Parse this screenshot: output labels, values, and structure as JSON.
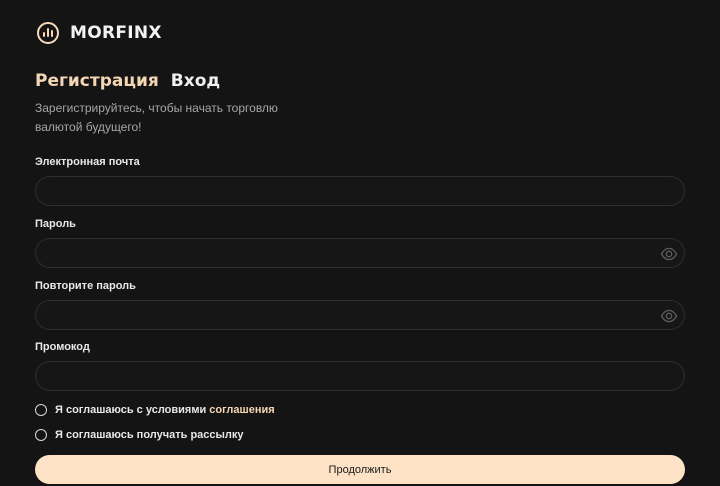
{
  "header": {
    "brand": "MORFINX",
    "logo_icon": "chart-bars-circle-icon"
  },
  "tabs": [
    {
      "label": "Регистрация",
      "active": true
    },
    {
      "label": "Вход",
      "active": false
    }
  ],
  "subtitle": "Зарегистрируйтесь, чтобы начать торговлю валютой будущего!",
  "form": {
    "email": {
      "label": "Электронная почта",
      "value": "",
      "placeholder": ""
    },
    "password": {
      "label": "Пароль",
      "value": "",
      "placeholder": "",
      "icon": "eye-icon"
    },
    "password_repeat": {
      "label": "Повторите пароль",
      "value": "",
      "placeholder": "",
      "icon": "eye-icon"
    },
    "promo": {
      "label": "Промокод",
      "value": "",
      "placeholder": ""
    }
  },
  "agreements": {
    "terms_prefix": "Я соглашаюсь с условиями ",
    "terms_link": "соглашения",
    "newsletter": "Я соглашаюсь получать рассылку"
  },
  "submit_label": "Продолжить",
  "colors": {
    "background": "#141414",
    "accent": "#f4d6b4",
    "button": "#fde2c6",
    "field_border": "#2e2e2e"
  }
}
